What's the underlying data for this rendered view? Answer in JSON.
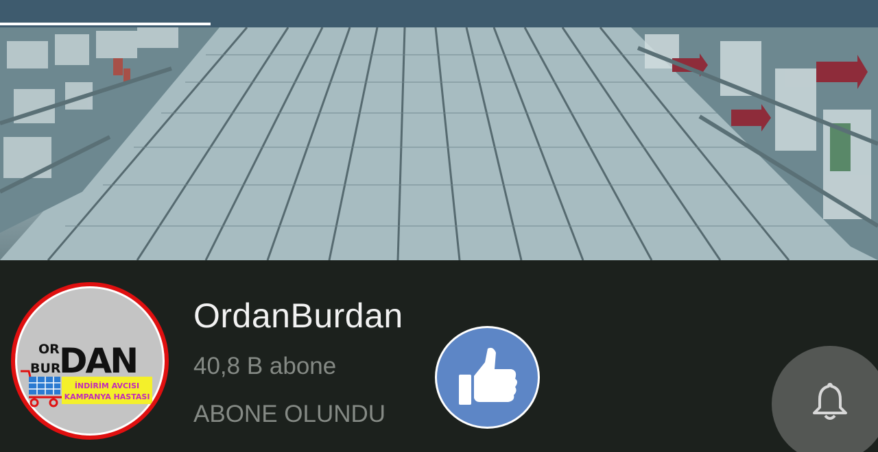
{
  "video": {
    "progress_fraction": 0.24
  },
  "channel": {
    "name": "OrdanBurdan",
    "subscribers": "40,8 B abone",
    "subscribe_status": "ABONE OLUNDU"
  },
  "avatar": {
    "logo_text": "ORBURDAN İNDİRİM AVCISI KAMPANYA HASTASI"
  },
  "icons": {
    "like": "thumbs-up-icon",
    "bell": "bell-icon",
    "cart": "shopping-cart-icon"
  },
  "colors": {
    "top_bar": "#3e5b6e",
    "panel_background": "#1c211d",
    "like_button": "#5d86c6",
    "avatar_ring": "#e01010",
    "logo_yellow": "#f4f02a"
  }
}
